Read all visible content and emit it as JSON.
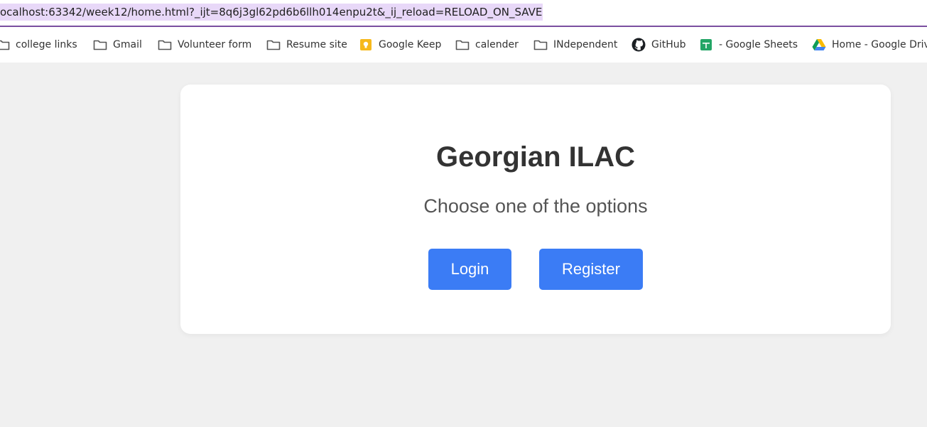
{
  "browser": {
    "url": "ocalhost:63342/week12/home.html?_ijt=8q6j3gl62pd6b6llh014enpu2t&_ij_reload=RELOAD_ON_SAVE"
  },
  "bookmarks": [
    {
      "label": "college links",
      "icon": "folder-icon"
    },
    {
      "label": "Gmail",
      "icon": "folder-icon"
    },
    {
      "label": "Volunteer form",
      "icon": "folder-icon"
    },
    {
      "label": "Resume site",
      "icon": "folder-icon"
    },
    {
      "label": "Google Keep",
      "icon": "google-keep-icon"
    },
    {
      "label": "calender",
      "icon": "folder-icon"
    },
    {
      "label": "INdependent",
      "icon": "folder-icon"
    },
    {
      "label": "GitHub",
      "icon": "github-icon"
    },
    {
      "label": "- Google Sheets",
      "icon": "google-sheets-icon"
    },
    {
      "label": "Home - Google Drive",
      "icon": "google-drive-icon"
    }
  ],
  "card": {
    "title": "Georgian ILAC",
    "subtitle": "Choose one of the options",
    "login_label": "Login",
    "register_label": "Register"
  },
  "colors": {
    "button": "#3b7cf5",
    "page_background": "#f0f0f0",
    "url_highlight": "#e8d8f8"
  }
}
